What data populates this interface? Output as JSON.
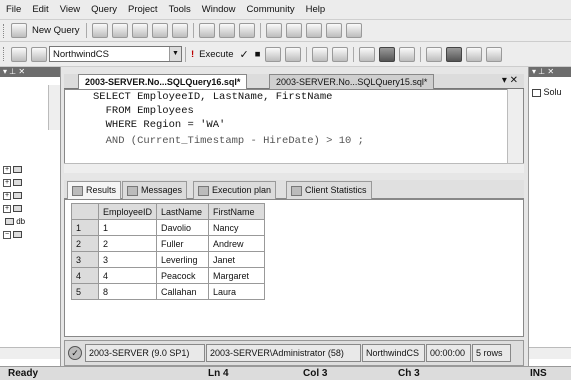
{
  "menu": [
    "File",
    "Edit",
    "View",
    "Query",
    "Project",
    "Tools",
    "Window",
    "Community",
    "Help"
  ],
  "toolbar1": {
    "new_query": "New Query"
  },
  "toolbar2": {
    "database": "NorthwindCS",
    "execute": "Execute",
    "execute_glyph": "!"
  },
  "tabs": [
    {
      "label": "2003-SERVER.No...SQLQuery16.sql*",
      "active": true
    },
    {
      "label": "2003-SERVER.No...SQLQuery15.sql*",
      "active": false
    }
  ],
  "editor": {
    "lines": [
      "SELECT EmployeeID, LastName, FirstName",
      "  FROM Employees",
      "  WHERE Region = 'WA'",
      "  AND (Current_Timestamp - HireDate) > 10 ;"
    ]
  },
  "results_tabs": [
    "Results",
    "Messages",
    "Execution plan",
    "Client Statistics"
  ],
  "grid": {
    "columns": [
      "EmployeeID",
      "LastName",
      "FirstName"
    ],
    "rows": [
      {
        "n": "1",
        "EmployeeID": "1",
        "LastName": "Davolio",
        "FirstName": "Nancy"
      },
      {
        "n": "2",
        "EmployeeID": "2",
        "LastName": "Fuller",
        "FirstName": "Andrew"
      },
      {
        "n": "3",
        "EmployeeID": "3",
        "LastName": "Leverling",
        "FirstName": "Janet"
      },
      {
        "n": "4",
        "EmployeeID": "4",
        "LastName": "Peacock",
        "FirstName": "Margaret"
      },
      {
        "n": "5",
        "EmployeeID": "8",
        "LastName": "Callahan",
        "FirstName": "Laura"
      }
    ]
  },
  "query_status": {
    "server": "2003-SERVER (9.0 SP1)",
    "user": "2003-SERVER\\Administrator (58)",
    "database": "NorthwindCS",
    "time": "00:00:00",
    "rows": "5 rows"
  },
  "right_panel": {
    "label": "Solu"
  },
  "left_panel": {
    "db_label": "db"
  },
  "status_bar": {
    "state": "Ready",
    "line": "Ln 4",
    "col": "Col 3",
    "ch": "Ch 3",
    "mode": "INS"
  },
  "colors": {
    "panel_header": "#6d6d6d",
    "editor_bg": "#ffffff"
  }
}
